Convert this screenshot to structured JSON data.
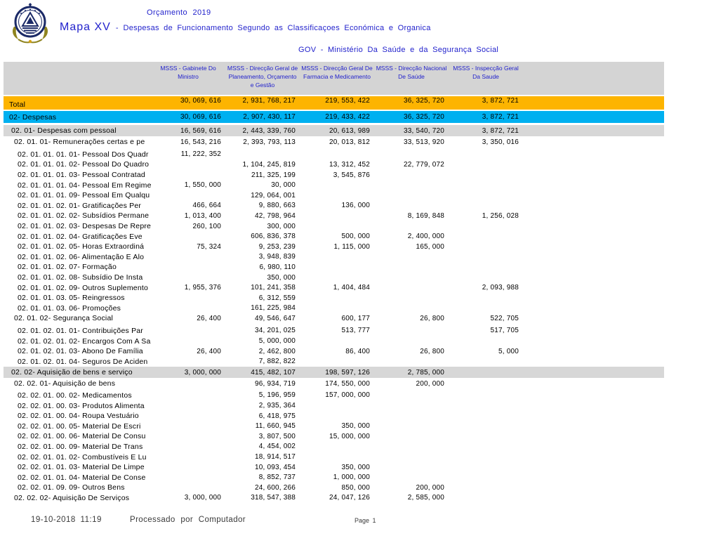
{
  "header": {
    "budget_title": "Orçamento 2019",
    "map_label": "Mapa XV",
    "map_separator": "-",
    "map_subtitle": "Despesas de Funcionamento Segundo as Classificaçoes Económica e Organica",
    "org_line": "GOV - Ministério Da Saúde e da Segurança Social"
  },
  "logo": {
    "name": "national-emblem",
    "ring_color": "#1b2a67",
    "branch_color": "#8f841f",
    "accent_color": "#d4a017"
  },
  "colors": {
    "total_row": "#fdb400",
    "despesas_row": "#00b0f0",
    "section_row": "#d7d7d7",
    "header_band": "#d4d4d4",
    "blue_text": "#2222cc"
  },
  "table": {
    "column_headers": [
      "MSSS - Gabinete Do Ministro",
      "MSSS - Direcção Geral de Planeamento, Orçamento e Gestão",
      "MSSS - Direcção Geral De Farmacia e Medicamento",
      "MSSS - Direcção Nacional De Saúde",
      "MSSS - Inspecção Geral Da Saude"
    ],
    "rows": [
      {
        "label": "Total",
        "style": "total",
        "values": [
          "30, 069, 616",
          "2, 931, 768, 217",
          "219, 553, 422",
          "36, 325, 720",
          "3, 872, 721"
        ]
      },
      {
        "label": "02- Despesas",
        "style": "section1",
        "values": [
          "30, 069, 616",
          "2, 907, 430, 117",
          "219, 433, 422",
          "36, 325, 720",
          "3, 872, 721"
        ]
      },
      {
        "label": "02. 01- Despesas com pessoal",
        "style": "section2",
        "values": [
          "16, 569, 616",
          "2, 443, 339, 760",
          "20, 613, 989",
          "33, 540, 720",
          "3, 872, 721"
        ]
      },
      {
        "label": "02. 01. 01- Remunerações certas e pe",
        "style": "mid",
        "values": [
          "16, 543, 216",
          "2, 393, 793, 113",
          "20, 013, 812",
          "33, 513, 920",
          "3, 350, 016"
        ]
      },
      {
        "label": "02. 01. 01. 01. 01- Pessoal  Dos Quadr",
        "style": "leaf",
        "gap": "g3",
        "values": [
          "11, 222, 352",
          "",
          "",
          "",
          ""
        ]
      },
      {
        "label": "02. 01. 01. 01. 02- Pessoal  Do Quadro",
        "style": "leaf",
        "values": [
          "",
          "1, 104, 245, 819",
          "13, 312, 452",
          "22, 779, 072",
          ""
        ]
      },
      {
        "label": "02. 01. 01. 01. 03- Pessoal  Contratad",
        "style": "leaf",
        "values": [
          "",
          "211, 325, 199",
          "3, 545, 876",
          "",
          ""
        ]
      },
      {
        "label": "02. 01. 01. 01. 04- Pessoal  Em Regime",
        "style": "leaf",
        "values": [
          "1, 550, 000",
          "30, 000",
          "",
          "",
          ""
        ]
      },
      {
        "label": "02. 01. 01. 01. 09- Pessoal  Em Qualqu",
        "style": "leaf",
        "values": [
          "",
          "129, 064, 001",
          "",
          "",
          ""
        ]
      },
      {
        "label": "02. 01. 01. 02. 01- Gratificações  Per",
        "style": "leaf",
        "values": [
          "466, 664",
          "9, 880, 663",
          "136, 000",
          "",
          ""
        ]
      },
      {
        "label": "02. 01. 01. 02. 02- Subsídios  Permane",
        "style": "leaf",
        "values": [
          "1, 013, 400",
          "42, 798, 964",
          "",
          "8, 169, 848",
          "1, 256, 028"
        ]
      },
      {
        "label": "02. 01. 01. 02. 03- Despesas  De Repre",
        "style": "leaf",
        "values": [
          "260, 100",
          "300, 000",
          "",
          "",
          ""
        ]
      },
      {
        "label": "02. 01. 01. 02. 04- Gratificações  Eve",
        "style": "leaf",
        "values": [
          "",
          "606, 836, 378",
          "500, 000",
          "2, 400, 000",
          ""
        ]
      },
      {
        "label": "02. 01. 01. 02. 05- Horas  Extraordiná",
        "style": "leaf",
        "values": [
          "75, 324",
          "9, 253, 239",
          "1, 115, 000",
          "165, 000",
          ""
        ]
      },
      {
        "label": "02. 01. 01. 02. 06- Alimentação  E Alo",
        "style": "leaf",
        "values": [
          "",
          "3, 948, 839",
          "",
          "",
          ""
        ]
      },
      {
        "label": "02. 01. 01. 02. 07- Formação",
        "style": "leaf",
        "values": [
          "",
          "6, 980, 110",
          "",
          "",
          ""
        ]
      },
      {
        "label": "02. 01. 01. 02. 08- Subsídio  De Insta",
        "style": "leaf",
        "values": [
          "",
          "350, 000",
          "",
          "",
          ""
        ]
      },
      {
        "label": "02. 01. 01. 02. 09- Outros  Suplemento",
        "style": "leaf",
        "values": [
          "1, 955, 376",
          "101, 241, 358",
          "1, 404, 484",
          "",
          "2, 093, 988"
        ]
      },
      {
        "label": "02. 01. 01. 03. 05- Reingressos",
        "style": "leaf",
        "values": [
          "",
          "6, 312, 559",
          "",
          "",
          ""
        ]
      },
      {
        "label": "02. 01. 01. 03. 06- Promoções",
        "style": "leaf",
        "values": [
          "",
          "161, 225, 984",
          "",
          "",
          ""
        ]
      },
      {
        "label": "02. 01. 02- Segurança  Social",
        "style": "mid",
        "values": [
          "26, 400",
          "49, 546, 647",
          "600, 177",
          "26, 800",
          "522, 705"
        ]
      },
      {
        "label": "02. 01. 02. 01. 01- Contribuições  Par",
        "style": "leaf",
        "gap": "g3",
        "values": [
          "",
          "34, 201, 025",
          "513, 777",
          "",
          "517, 705"
        ]
      },
      {
        "label": "02. 01. 02. 01. 02- Encargos  Com A Sa",
        "style": "leaf",
        "values": [
          "",
          "5, 000, 000",
          "",
          "",
          ""
        ]
      },
      {
        "label": "02. 01. 02. 01. 03- Abono De Família",
        "style": "leaf",
        "values": [
          "26, 400",
          "2, 462, 800",
          "86, 400",
          "26, 800",
          "5, 000"
        ]
      },
      {
        "label": "02. 01. 02. 01. 04- Seguros  De Aciden",
        "style": "leaf",
        "values": [
          "",
          "7, 882, 822",
          "",
          "",
          ""
        ]
      },
      {
        "label": "02. 02- Aquisição de bens e serviço",
        "style": "section2",
        "values": [
          "3, 000, 000",
          "415, 482, 107",
          "198, 597, 126",
          "2, 785, 000",
          ""
        ]
      },
      {
        "label": "02. 02. 01- Aquisição de bens",
        "style": "mid",
        "values": [
          "",
          "96, 934, 719",
          "174, 550, 000",
          "200, 000",
          ""
        ]
      },
      {
        "label": "02. 02. 01. 00. 02- Medicamentos",
        "style": "leaf",
        "gap": "g2",
        "values": [
          "",
          "5, 196, 959",
          "157, 000, 000",
          "",
          ""
        ]
      },
      {
        "label": "02. 02. 01. 00. 03- Produtos  Alimenta",
        "style": "leaf",
        "values": [
          "",
          "2, 935, 364",
          "",
          "",
          ""
        ]
      },
      {
        "label": "02. 02. 01. 00. 04- Roupa  Vestuário",
        "style": "leaf",
        "values": [
          "",
          "6, 418, 975",
          "",
          "",
          ""
        ]
      },
      {
        "label": "02. 02. 01. 00. 05- Material  De Escri",
        "style": "leaf",
        "values": [
          "",
          "11, 660, 945",
          "350, 000",
          "",
          ""
        ]
      },
      {
        "label": "02. 02. 01. 00. 06- Material  De Consu",
        "style": "leaf",
        "values": [
          "",
          "3, 807, 500",
          "15, 000, 000",
          "",
          ""
        ]
      },
      {
        "label": "02. 02. 01. 00. 09- Material  De Trans",
        "style": "leaf",
        "values": [
          "",
          "4, 454, 002",
          "",
          "",
          ""
        ]
      },
      {
        "label": "02. 02. 01. 01. 02- Combustíveis  E Lu",
        "style": "leaf",
        "values": [
          "",
          "18, 914, 517",
          "",
          "",
          ""
        ]
      },
      {
        "label": "02. 02. 01. 01. 03- Material  De Limpe",
        "style": "leaf",
        "values": [
          "",
          "10, 093, 454",
          "350, 000",
          "",
          ""
        ]
      },
      {
        "label": "02. 02. 01. 01. 04- Material  De Conse",
        "style": "leaf",
        "values": [
          "",
          "8, 852, 737",
          "1, 000, 000",
          "",
          ""
        ]
      },
      {
        "label": "02. 02. 01. 09. 09- Outros Bens",
        "style": "leaf",
        "values": [
          "",
          "24, 600, 266",
          "850, 000",
          "200, 000",
          ""
        ]
      },
      {
        "label": "02. 02. 02- Aquisição De Serviços",
        "style": "mid",
        "values": [
          "3, 000, 000",
          "318, 547, 388",
          "24, 047, 126",
          "2, 585, 000",
          ""
        ]
      }
    ]
  },
  "footer": {
    "datetime": "19-10-2018  11:19",
    "processed": "Processado por Computador",
    "page": "Page 1"
  }
}
